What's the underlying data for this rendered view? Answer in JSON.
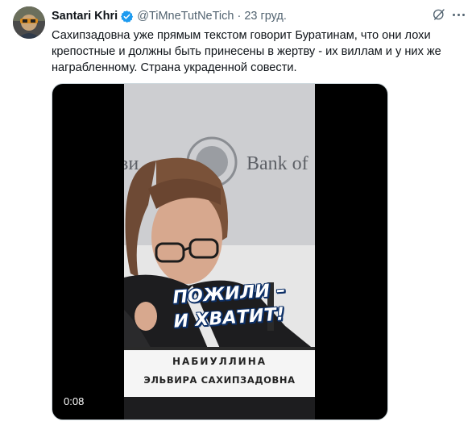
{
  "tweet": {
    "display_name": "Santari Khri",
    "handle": "@TiMneTutNeTich",
    "separator": "·",
    "date": "23 груд.",
    "text": "Сахипзадовна уже прямым текстом говорит Буратинам, что они лохи крепостные и должны быть принесены в жертву - их виллам и у них же награбленному. Страна украденной совести."
  },
  "video": {
    "backdrop_text": "Bank of",
    "backdrop_text_left": "ви",
    "caption_line1": "ПОЖИЛИ –",
    "caption_line2": "И ХВАТИТ!",
    "nameplate_surname": "НАБИУЛЛИНА",
    "nameplate_name": "ЭЛЬВИРА САХИПЗАДОВНА",
    "timer": "0:08"
  },
  "icons": {
    "verified": "verified-badge-icon",
    "grok": "grok-icon",
    "more": "more-icon"
  },
  "colors": {
    "verified_blue": "#1d9bf0",
    "secondary_text": "#536471",
    "caption_outline": "#0c2f66"
  }
}
